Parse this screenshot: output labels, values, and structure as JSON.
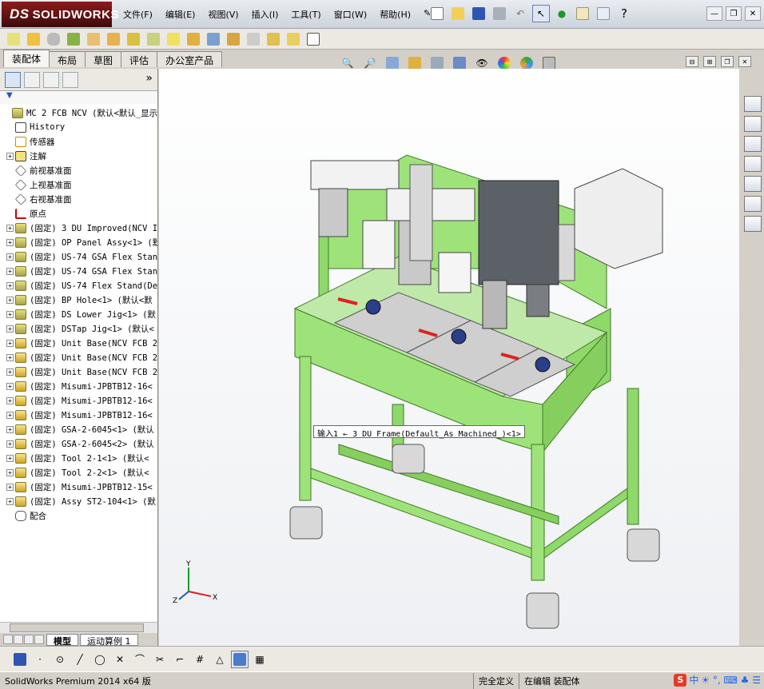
{
  "app": {
    "brand_mark": "DS",
    "brand": "SOLIDWORKS"
  },
  "menu": [
    "文件(F)",
    "编辑(E)",
    "视图(V)",
    "插入(I)",
    "工具(T)",
    "窗口(W)",
    "帮助(H)"
  ],
  "help_glyph": "?",
  "tabs": [
    "装配体",
    "布局",
    "草图",
    "评估",
    "办公室产品"
  ],
  "panel_more": "»",
  "tree": [
    {
      "label": "MC 2 FCB NCV  (默认<默认_显示",
      "icon": "root",
      "exp": "none"
    },
    {
      "label": "History",
      "icon": "hist",
      "exp": "none"
    },
    {
      "label": "传感器",
      "icon": "sens",
      "exp": "none"
    },
    {
      "label": "注解",
      "icon": "note",
      "exp": "+"
    },
    {
      "label": "前视基准面",
      "icon": "plane",
      "exp": "none"
    },
    {
      "label": "上视基准面",
      "icon": "plane",
      "exp": "none"
    },
    {
      "label": "右视基准面",
      "icon": "plane",
      "exp": "none"
    },
    {
      "label": "原点",
      "icon": "orig",
      "exp": "none"
    },
    {
      "label": "(固定) 3 DU Improved(NCV I",
      "icon": "asm",
      "exp": "+"
    },
    {
      "label": "(固定) OP Panel Assy<1> (默",
      "icon": "asm",
      "exp": "+"
    },
    {
      "label": "(固定) US-74 GSA Flex Stan",
      "icon": "asm",
      "exp": "+"
    },
    {
      "label": "(固定) US-74 GSA Flex Stan",
      "icon": "asm",
      "exp": "+"
    },
    {
      "label": "(固定) US-74 Flex Stand(De",
      "icon": "asm",
      "exp": "+"
    },
    {
      "label": "(固定) BP Hole<1> (默认<默",
      "icon": "asm",
      "exp": "+"
    },
    {
      "label": "(固定) DS Lower Jig<1> (默",
      "icon": "asm",
      "exp": "+"
    },
    {
      "label": "(固定) DSTap Jig<1> (默认<",
      "icon": "asm",
      "exp": "+"
    },
    {
      "label": "(固定) Unit Base(NCV FCB 2",
      "icon": "sub",
      "exp": "+"
    },
    {
      "label": "(固定) Unit Base(NCV FCB 2",
      "icon": "sub",
      "exp": "+"
    },
    {
      "label": "(固定) Unit Base(NCV FCB 2",
      "icon": "sub",
      "exp": "+"
    },
    {
      "label": "(固定) Misumi-JPBTB12-16<",
      "icon": "sub",
      "exp": "+"
    },
    {
      "label": "(固定) Misumi-JPBTB12-16<",
      "icon": "sub",
      "exp": "+"
    },
    {
      "label": "(固定) Misumi-JPBTB12-16<",
      "icon": "sub",
      "exp": "+"
    },
    {
      "label": "(固定) GSA-2-6045<1> (默认",
      "icon": "sub",
      "exp": "+"
    },
    {
      "label": "(固定) GSA-2-6045<2> (默认",
      "icon": "sub",
      "exp": "+"
    },
    {
      "label": "(固定) Tool 2-1<1> (默认<",
      "icon": "sub",
      "exp": "+"
    },
    {
      "label": "(固定) Tool 2-2<1> (默认<",
      "icon": "sub",
      "exp": "+"
    },
    {
      "label": "(固定) Misumi-JPBTB12-15<",
      "icon": "sub",
      "exp": "+"
    },
    {
      "label": "(固定) Assy ST2-104<1> (默",
      "icon": "sub",
      "exp": "+"
    },
    {
      "label": "配合",
      "icon": "mate",
      "exp": "none"
    }
  ],
  "bottom_tabs": [
    "模型",
    "运动算例 1"
  ],
  "tooltip": "输入1 ← 3 DU Frame(Default_As Machined_)<1>",
  "triad": {
    "x": "X",
    "y": "Y",
    "z": "Z"
  },
  "status": {
    "product": "SolidWorks Premium 2014 x64 版",
    "defined": "完全定义",
    "editing": "在编辑 装配体"
  },
  "ime": {
    "logo": "S",
    "lang": "中",
    "marks": "☀ °, ⌨ ♣ ☰"
  },
  "colors": {
    "frame": "#9ee37a",
    "frame_dark": "#6fb848",
    "plate": "#cfcfcf",
    "brand": "#7a1111"
  }
}
